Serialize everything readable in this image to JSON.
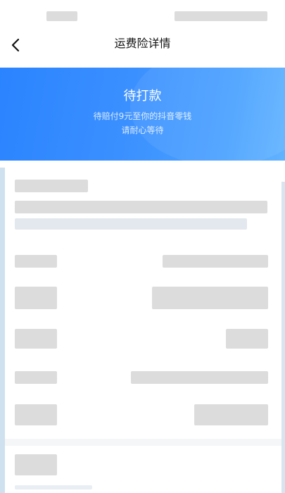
{
  "nav": {
    "title": "运费险详情",
    "back_icon": "chevron-left-icon"
  },
  "banner": {
    "status": "待打款",
    "line1": "待赔付9元至你的抖音零钱",
    "line2": "请耐心等待",
    "gradient_start": "#2b84ff",
    "gradient_end": "#62b3ff"
  }
}
